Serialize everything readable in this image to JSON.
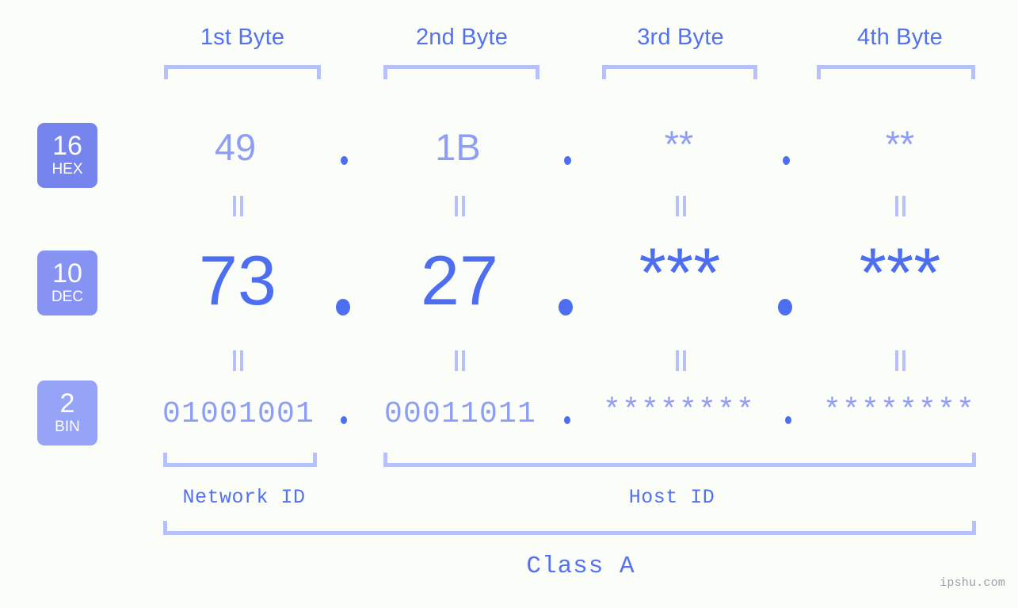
{
  "page": {
    "background": "#fbfdf8",
    "accent_strong": "#4e6ef2",
    "accent_light": "#8f9ef5",
    "accent_rule": "#b6c0fb",
    "watermark": "ipshu.com"
  },
  "columns": [
    {
      "header": "1st Byte"
    },
    {
      "header": "2nd Byte"
    },
    {
      "header": "3rd Byte"
    },
    {
      "header": "4th Byte"
    }
  ],
  "bases": [
    {
      "number": "16",
      "name": "HEX",
      "color": "#7684ee"
    },
    {
      "number": "10",
      "name": "DEC",
      "color": "#8693f2"
    },
    {
      "number": "2",
      "name": "BIN",
      "color": "#95a4f7"
    }
  ],
  "rows": {
    "hex": {
      "values": [
        "49",
        "1B",
        "**",
        "**"
      ]
    },
    "dec": {
      "values": [
        "73",
        "27",
        "***",
        "***"
      ]
    },
    "bin": {
      "values": [
        "01001001",
        "00011011",
        "********",
        "********"
      ]
    }
  },
  "separators": {
    "dot": ".",
    "equals": "="
  },
  "segments": {
    "network_id": "Network ID",
    "host_id": "Host ID",
    "class": "Class A"
  }
}
